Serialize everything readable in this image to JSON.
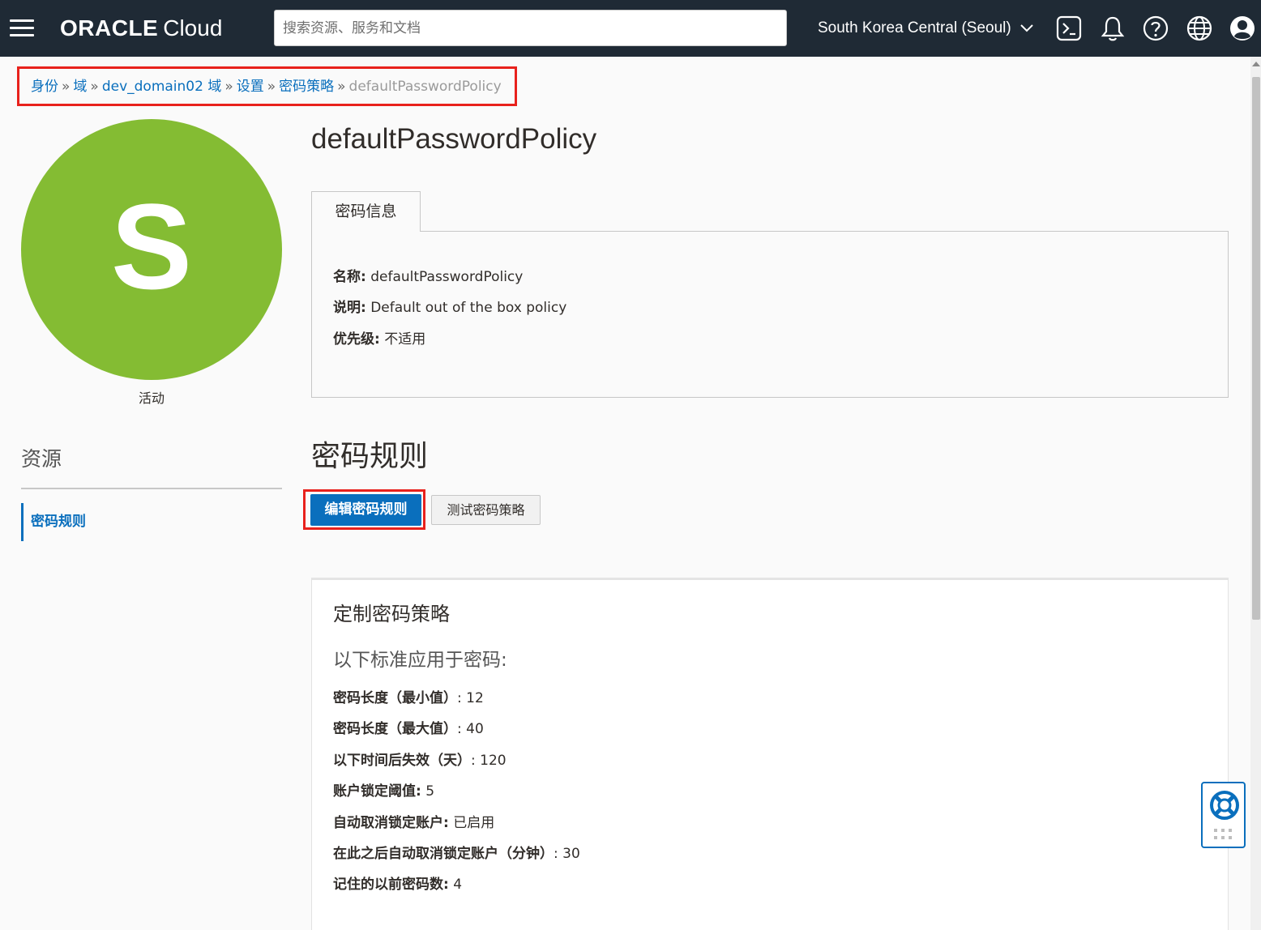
{
  "header": {
    "logo_brand": "ORACLE",
    "logo_sub": "Cloud",
    "search_placeholder": "搜索资源、服务和文档",
    "region": "South Korea Central (Seoul)",
    "icons": [
      "menu-icon",
      "cloud-shell-icon",
      "bell-icon",
      "help-icon",
      "globe-icon",
      "user-icon"
    ]
  },
  "breadcrumb": {
    "items": [
      "身份",
      "域",
      "dev_domain02 域",
      "设置",
      "密码策略"
    ],
    "current": "defaultPasswordPolicy",
    "separator": "»"
  },
  "avatar": {
    "letter": "S",
    "status": "活动",
    "color": "#84bc33"
  },
  "page": {
    "title": "defaultPasswordPolicy"
  },
  "info_tab": {
    "label": "密码信息",
    "rows": [
      {
        "label": "名称:",
        "value": "defaultPasswordPolicy"
      },
      {
        "label": "说明:",
        "value": "Default out of the box policy"
      },
      {
        "label": "优先级:",
        "value": "不适用"
      }
    ]
  },
  "resources": {
    "title": "资源",
    "items": [
      "密码规则"
    ]
  },
  "rules": {
    "title": "密码规则",
    "edit_button": "编辑密码规则",
    "test_button": "测试密码策略",
    "card_title": "定制密码策略",
    "card_subtitle": "以下标准应用于密码:",
    "criteria": [
      {
        "label": "密码长度（最小值）",
        "value": ": 12"
      },
      {
        "label": "密码长度（最大值）",
        "value": ": 40"
      },
      {
        "label": "以下时间后失效（天）",
        "value": ": 120"
      },
      {
        "label": "账户锁定阈值:",
        "value": "5"
      },
      {
        "label": "自动取消锁定账户:",
        "value": "已启用"
      },
      {
        "label": "在此之后自动取消锁定账户（分钟）",
        "value": ": 30"
      },
      {
        "label": "记住的以前密码数:",
        "value": "4"
      }
    ]
  },
  "colors": {
    "header_bg": "#1f2a35",
    "link": "#0a6fbd",
    "primary_button": "#0a6fbd",
    "highlight": "#e8211c"
  }
}
